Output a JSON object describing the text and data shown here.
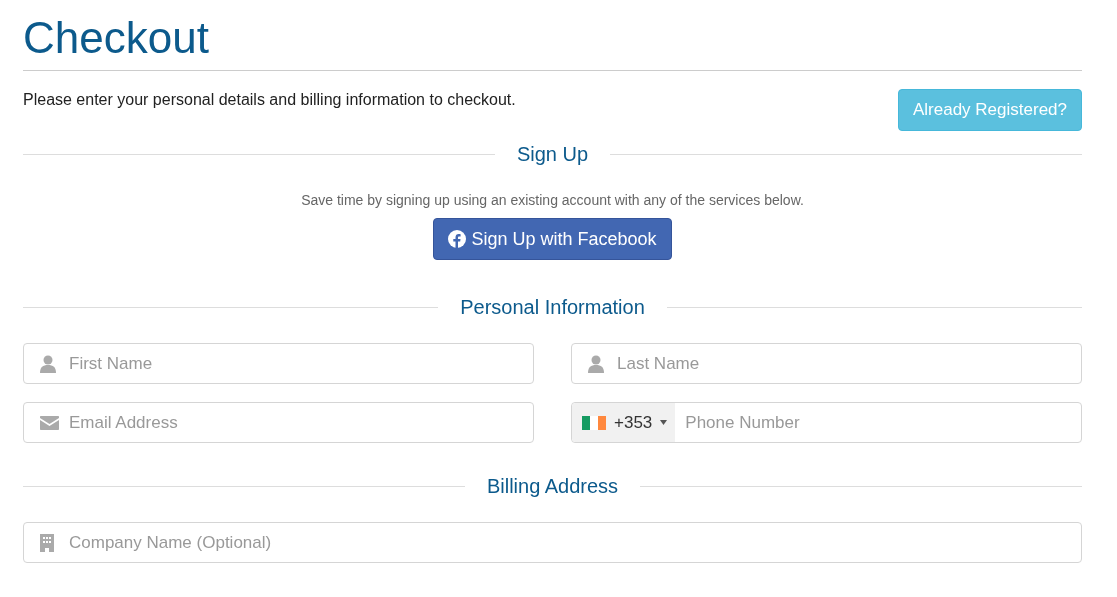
{
  "title": "Checkout",
  "intro": "Please enter your personal details and billing information to checkout.",
  "login_button": "Already Registered?",
  "signup": {
    "heading": "Sign Up",
    "note": "Save time by signing up using an existing account with any of the services below.",
    "facebook_button": "Sign Up with Facebook"
  },
  "personal": {
    "heading": "Personal Information",
    "fields": [
      {
        "kind": "person",
        "placeholder": "First Name"
      },
      {
        "kind": "person",
        "placeholder": "Last Name"
      },
      {
        "kind": "email",
        "placeholder": "Email Address"
      },
      {
        "kind": "phone",
        "dial_code": "+353",
        "placeholder": "Phone Number"
      }
    ]
  },
  "billing": {
    "heading": "Billing Address",
    "fields": [
      {
        "kind": "company",
        "placeholder": "Company Name (Optional)"
      }
    ]
  }
}
